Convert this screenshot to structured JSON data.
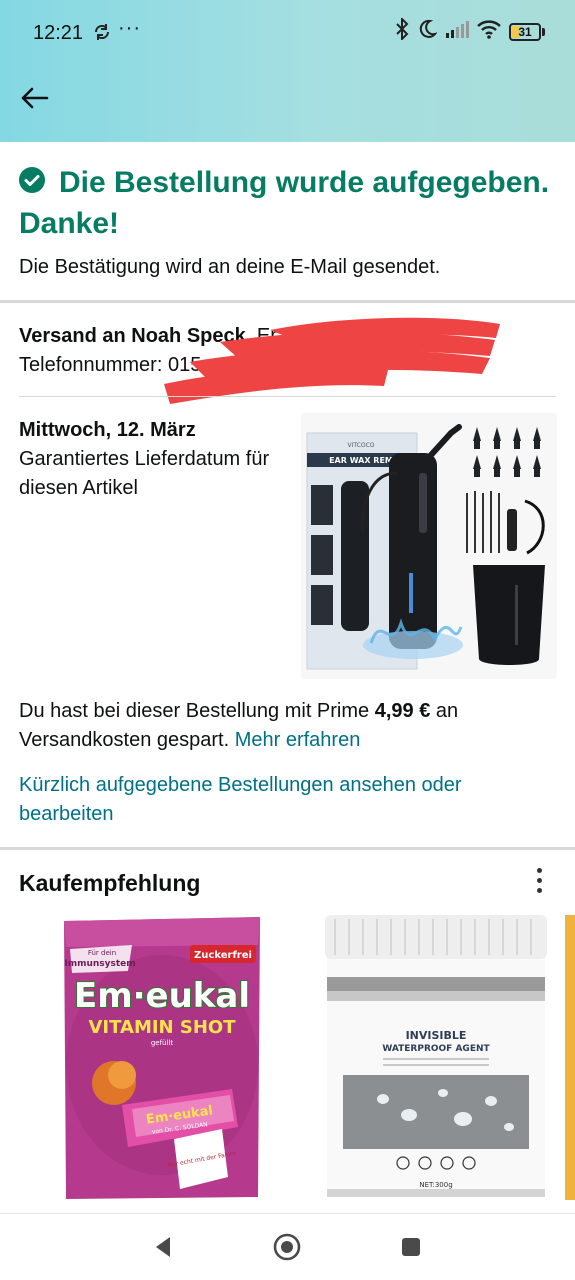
{
  "status_bar": {
    "time": "12:21",
    "more": "···",
    "battery_level": "31",
    "icons": [
      "sync-icon",
      "bluetooth-icon",
      "moon-icon",
      "signal-icon",
      "wifi-icon",
      "battery-icon"
    ]
  },
  "header": {
    "back_icon": "arrow-left-icon",
    "gradient_colors": [
      "#84d8e3",
      "#a9ddd9"
    ]
  },
  "confirmation": {
    "title": "Die Bestellung wurde aufgegeben. Danke!",
    "subtitle": "Die Bestätigung wird an deine E-Mail gesendet.",
    "accent_color": "#067d62"
  },
  "shipping": {
    "prefix": "Versand an Noah Speck",
    "suffix": ", Er",
    "phone_label": "Telefonnummer: 01",
    "phone_partial": "5"
  },
  "delivery": {
    "date": "Mittwoch, 12. März",
    "note": "Garantiertes Lieferdatum für diesen Artikel"
  },
  "product": {
    "brand": "VITCOCO",
    "box_text": "EAR WAX REM"
  },
  "savings": {
    "text_before": "Du hast bei dieser Bestellung mit Prime ",
    "amount": "4,99 €",
    "text_after": " an Versandkosten gespart. ",
    "link": "Mehr erfahren"
  },
  "recent_orders_link": "Kürzlich aufgegebene Bestellungen ansehen oder bearbeiten",
  "recommendations": {
    "title": "Kaufempfehlung",
    "items": [
      {
        "brand": "Em·eukal",
        "line": "VITAMIN SHOT",
        "sub": "gefüllt",
        "badge": "Zuckerfrei",
        "tag_top": "Für dein",
        "tag_main": "Immunsystem",
        "wrapper_note": "Nur echt mit der Fahne",
        "maker": "von Dr. C. SOLDAN"
      },
      {
        "title_1": "INVISIBLE",
        "title_2": "WATERPROOF AGENT",
        "weight": "NET:300g"
      }
    ]
  },
  "nav": {
    "icons": [
      "nav-back-icon",
      "nav-home-icon",
      "nav-recents-icon"
    ]
  }
}
